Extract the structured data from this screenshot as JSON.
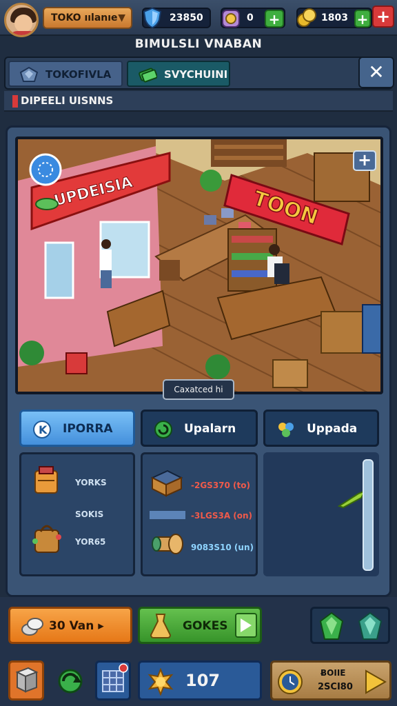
{
  "header": {
    "player_name": "TOKO ıılanıe",
    "shield_value": "23850",
    "gem_value": "0",
    "coin_value": "1803",
    "title": "BIMULSLI VNABAN"
  },
  "tabs": [
    {
      "label": "TOKOFIVLA",
      "icon": "crystal-icon"
    },
    {
      "label": "SVYCHUINI",
      "icon": "cash-icon"
    }
  ],
  "close_label": "✕",
  "section_title": "DIPEELI UISNNS",
  "scene": {
    "store_sign": "UPDEISIA",
    "banner_text": "TOON",
    "caption": "Caxatced hi"
  },
  "category_buttons": [
    {
      "label": "IPORRA",
      "icon": "info-icon"
    },
    {
      "label": "Upalarn",
      "icon": "refresh-icon"
    },
    {
      "label": "Uppada",
      "icon": "puzzle-icon"
    }
  ],
  "inventory_left": [
    {
      "text": "YORKS",
      "icon": "package-icon"
    },
    {
      "text": "SOKIS",
      "icon": "none"
    },
    {
      "text": "YOR65",
      "icon": "bag-icon"
    }
  ],
  "inventory_mid": [
    {
      "text": "-2GS370 (to)",
      "icon": "box-icon",
      "color": "#f05a4a"
    },
    {
      "text": "-3LGS3A (on)",
      "icon": "bar-icon",
      "color": "#f05a4a"
    },
    {
      "text": "9083S10 (un)",
      "icon": "pipe-icon",
      "color": "#8fd4ff"
    }
  ],
  "actions": {
    "buy_label": "30 Van ▸",
    "boost_label": "GOKES",
    "counter_value": "107",
    "timer_line1": "ɃOIIE",
    "timer_line2": "2SCI80"
  },
  "colors": {
    "accent_blue": "#4490dc",
    "accent_orange": "#e67818",
    "accent_green": "#37942a",
    "panel": "#3a5475"
  }
}
